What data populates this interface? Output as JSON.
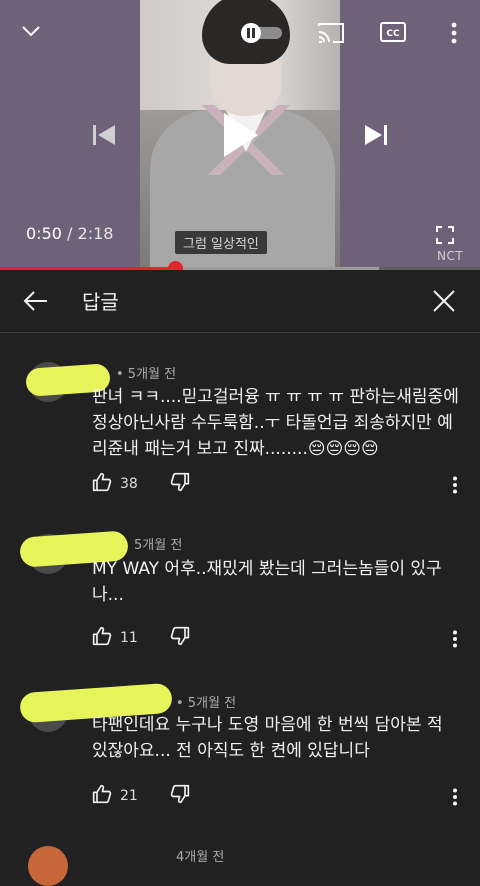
{
  "player": {
    "current_time": "0:50",
    "duration_sep": "/ 2:18",
    "subtitle": "그럼 일상적인",
    "watermark": "NCT",
    "progress_played": 0.366,
    "progress_buffered": 0.79,
    "icons": [
      "chevron-down-icon",
      "pause-toggle-icon",
      "cast-icon",
      "closed-captions-icon",
      "more-vert-icon",
      "previous-icon",
      "play-icon",
      "next-icon",
      "fullscreen-icon"
    ]
  },
  "replies": {
    "title": "답글",
    "back_icon": "arrow-left-icon",
    "close_icon": "close-icon"
  },
  "comments": [
    {
      "time": "• 5개월 전",
      "text": "판녀 ㅋㅋ....믿고걸러융 ㅠ ㅠ ㅠ ㅠ 판하는새림중에 정상아닌사람 수두룩함..ㅜ 타돌언급 죄송하지만 예리쥰내 패는거 보고 진짜........😔😔😔😔",
      "likes": "38"
    },
    {
      "time": "5개월 전",
      "text": "MY WAY 어후..재밌게 봤는데 그러는놈들이 있구나...",
      "likes": "11"
    },
    {
      "time": "• 5개월 전",
      "text": "타팬인데요 누구나 도영 마음에 한 번씩 담아본 적 있잖아요... 전 아직도 한 켠에 있답니다",
      "likes": "21"
    },
    {
      "time": "4개월 전",
      "text": "",
      "likes": ""
    }
  ],
  "colors": {
    "background": "#212121",
    "progress_red": "#e0262b",
    "redaction_yellow": "#e8f55a"
  }
}
